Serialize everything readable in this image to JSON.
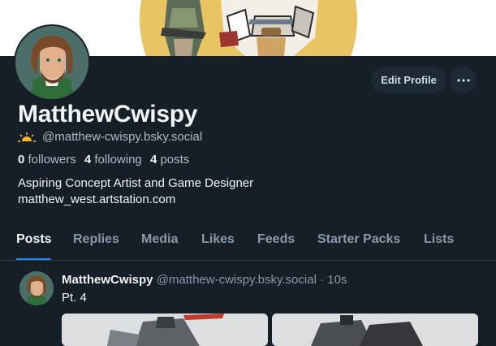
{
  "profile": {
    "display_name": "MatthewCwispy",
    "handle": "@matthew-cwispy.bsky.social",
    "followers_count": "0",
    "followers_label": "followers",
    "following_count": "4",
    "following_label": "following",
    "posts_count": "4",
    "posts_label": "posts",
    "bio_line1": "Aspiring Concept Artist and Game Designer",
    "bio_line2": "matthew_west.artstation.com"
  },
  "actions": {
    "edit_profile_label": "Edit Profile",
    "more_label": "···"
  },
  "tabs": [
    "Posts",
    "Replies",
    "Media",
    "Likes",
    "Feeds",
    "Starter Packs",
    "Lists"
  ],
  "active_tab": "Posts",
  "post": {
    "author": "MatthewCwispy",
    "handle": "@matthew-cwispy.bsky.social",
    "separator": "·",
    "time": "10s",
    "text": "Pt. 4"
  },
  "colors": {
    "background": "#161e27",
    "accent": "#208bfe",
    "banner_sun": "#e8c463"
  },
  "icons": {
    "handle_badge": "sun-icon",
    "more": "ellipsis-icon"
  }
}
